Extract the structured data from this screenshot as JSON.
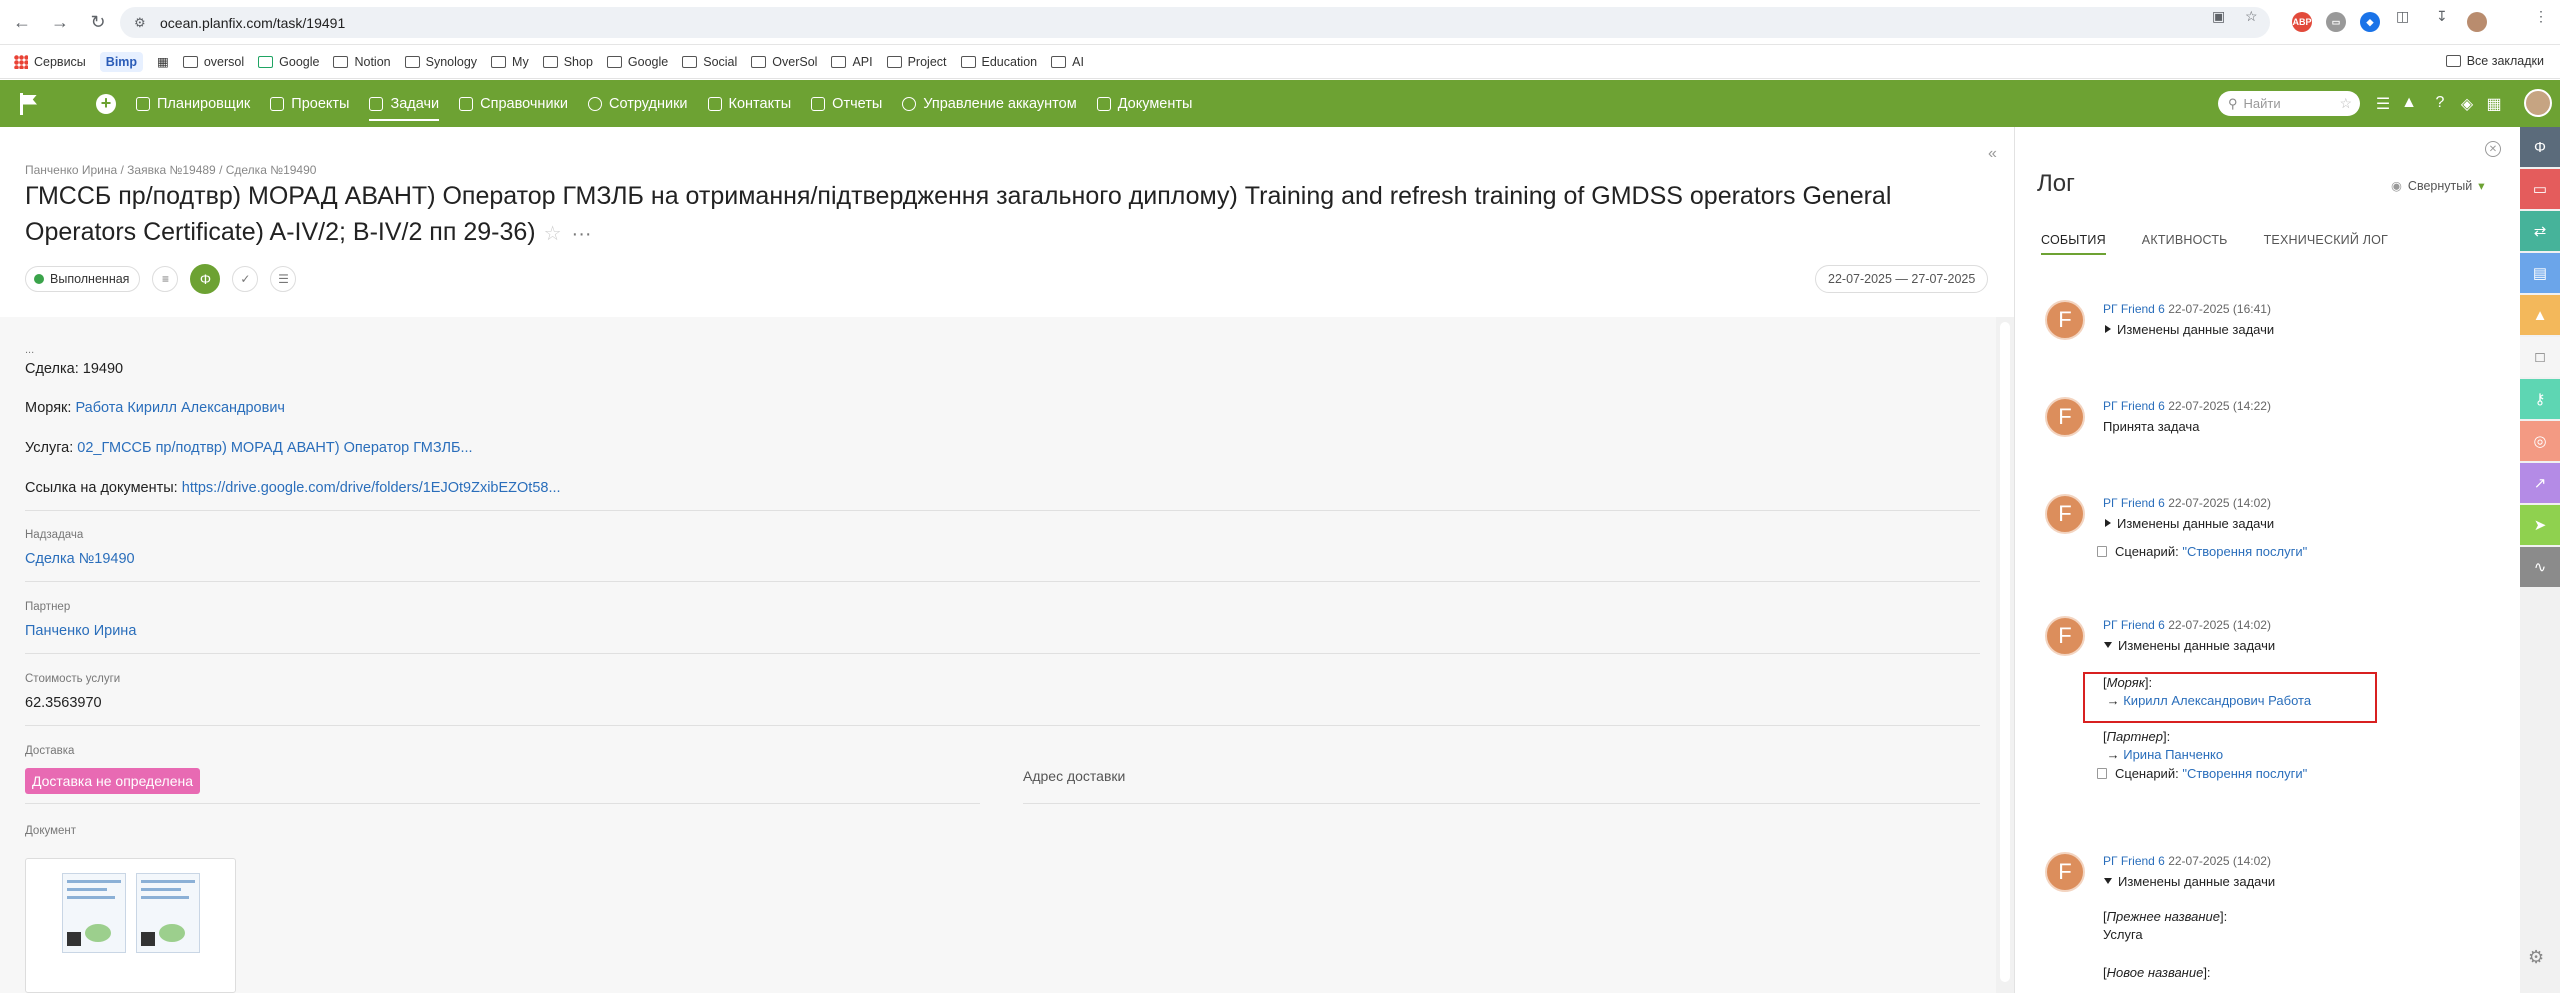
{
  "browser": {
    "url": "ocean.planfix.com/task/19491",
    "bookmarks": [
      {
        "label": "Сервисы",
        "icon": "apps-icon"
      },
      {
        "label": "Bimp",
        "icon": "bimp-badge"
      },
      {
        "label": "",
        "icon": "grid-icon"
      },
      {
        "label": "oversol",
        "icon": "bookmark-icon"
      },
      {
        "label": "Google",
        "icon": "drive-icon"
      },
      {
        "label": "Notion",
        "icon": "notion-icon"
      },
      {
        "label": "Synology",
        "icon": "folder-icon"
      },
      {
        "label": "My",
        "icon": "folder-icon"
      },
      {
        "label": "Shop",
        "icon": "folder-icon"
      },
      {
        "label": "Google",
        "icon": "folder-icon"
      },
      {
        "label": "Social",
        "icon": "folder-icon"
      },
      {
        "label": "OverSol",
        "icon": "folder-icon"
      },
      {
        "label": "API",
        "icon": "folder-icon"
      },
      {
        "label": "Project",
        "icon": "folder-icon"
      },
      {
        "label": "Education",
        "icon": "folder-icon"
      },
      {
        "label": "AI",
        "icon": "folder-icon"
      }
    ],
    "all_bookmarks": "Все закладки"
  },
  "header": {
    "menu": [
      {
        "label": "Планировщик",
        "active": false
      },
      {
        "label": "Проекты",
        "active": false
      },
      {
        "label": "Задачи",
        "active": true
      },
      {
        "label": "Справочники",
        "active": false
      },
      {
        "label": "Сотрудники",
        "active": false
      },
      {
        "label": "Контакты",
        "active": false
      },
      {
        "label": "Отчеты",
        "active": false
      },
      {
        "label": "Управление аккаунтом",
        "active": false
      },
      {
        "label": "Документы",
        "active": false
      }
    ],
    "search_placeholder": "Найти",
    "brand_color": "#6da233"
  },
  "task": {
    "breadcrumb": "Панченко Ирина / Заявка №19489 / Сделка №19490",
    "title": "ГМССБ пр/подтвр) МОРАД АВАНТ) Оператор ГМЗЛБ на отримання/підтвердження загального диплому) Training and refresh training of GMDSS operators General Operators Certificate) A-IV/2; B-IV/2 пп 29-36)",
    "status": "Выполненная",
    "status_color": "#3aa34a",
    "dates": "22-07-2025 — 27-07-2025",
    "description": {
      "ellipsis": "...",
      "deal": "Сделка: 19490",
      "seaman_label": "Моряк: ",
      "seaman_link": "Работа Кирилл Александрович",
      "service_label": "Услуга: ",
      "service_link": "02_ГМССБ пр/подтвр) МОРАД АВАНТ) Оператор ГМЗЛБ...",
      "docs_label": "Ссылка на документы: ",
      "docs_link": "https://drive.google.com/drive/folders/1EJOt9ZxibEZOt58..."
    },
    "fields": {
      "parent_label": "Надзадача",
      "parent_value": "Сделка №19490",
      "partner_label": "Партнер",
      "partner_value": "Панченко Ирина",
      "cost_label": "Стоимость услуги",
      "cost_value": "62.3563970",
      "delivery_label": "Доставка",
      "delivery_value": "Доставка не определена",
      "delivery_address_label": "Адрес доставки",
      "document_label": "Документ"
    }
  },
  "log": {
    "title": "Лог",
    "mode": "Свернутый",
    "tabs": [
      "СОБЫТИЯ",
      "АКТИВНОСТЬ",
      "ТЕХНИЧЕСКИЙ ЛОГ"
    ],
    "entries": [
      {
        "author": "РГ Friend 6",
        "time": "22-07-2025 (16:41)",
        "action": "Изменены данные задачи",
        "expanded": false
      },
      {
        "author": "РГ Friend 6",
        "time": "22-07-2025 (14:22)",
        "action": "Принята задача"
      },
      {
        "author": "РГ Friend 6",
        "time": "22-07-2025 (14:02)",
        "action": "Изменены данные задачи",
        "expanded": false,
        "scenario_label": "Сценарий: ",
        "scenario": "\"Створення послуги\""
      },
      {
        "author": "РГ Friend 6",
        "time": "22-07-2025 (14:02)",
        "action": "Изменены данные задачи",
        "expanded": true,
        "changes": [
          {
            "field": "Моряк",
            "value": "Кирилл Александрович Работа"
          },
          {
            "field": "Партнер",
            "value": "Ирина Панченко"
          }
        ],
        "scenario_label": "Сценарий: ",
        "scenario": "\"Створення послуги\""
      },
      {
        "author": "РГ Friend 6",
        "time": "22-07-2025 (14:02)",
        "action": "Изменены данные задачи",
        "expanded": true,
        "old_name_label": "Прежнее название",
        "old_name": "Услуга",
        "new_name_label": "Новое название"
      }
    ],
    "avatar_letter": "F"
  },
  "rail_colors": [
    "#5b6b7b",
    "#e45c5c",
    "#46b39a",
    "#6ba5ea",
    "#f3b85b",
    "#f5f5f5",
    "#5ed6b3",
    "#f39a83",
    "#b48be6",
    "#8fd14f",
    "#8b8b8b"
  ]
}
